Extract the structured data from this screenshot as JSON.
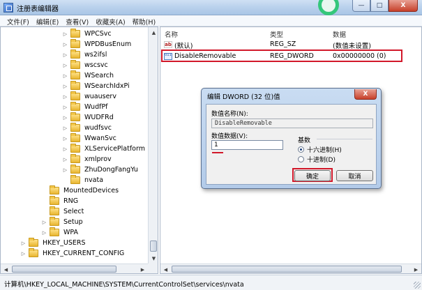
{
  "window": {
    "title": "注册表编辑器",
    "min": "—",
    "max": "□",
    "close": "X"
  },
  "menu": [
    "文件(F)",
    "编辑(E)",
    "查看(V)",
    "收藏夹(A)",
    "帮助(H)"
  ],
  "tree": {
    "items": [
      {
        "label": "WPCSvc",
        "expander": "▷"
      },
      {
        "label": "WPDBusEnum",
        "expander": "▷"
      },
      {
        "label": "ws2ifsl",
        "expander": "▷"
      },
      {
        "label": "wscsvc",
        "expander": "▷"
      },
      {
        "label": "WSearch",
        "expander": "▷"
      },
      {
        "label": "WSearchIdxPi",
        "expander": "▷"
      },
      {
        "label": "wuauserv",
        "expander": "▷"
      },
      {
        "label": "WudfPf",
        "expander": "▷"
      },
      {
        "label": "WUDFRd",
        "expander": "▷"
      },
      {
        "label": "wudfsvc",
        "expander": "▷"
      },
      {
        "label": "WwanSvc",
        "expander": "▷"
      },
      {
        "label": "XLServicePlatform",
        "expander": "▷"
      },
      {
        "label": "xmlprov",
        "expander": "▷"
      },
      {
        "label": "ZhuDongFangYu",
        "expander": "▷"
      },
      {
        "label": "nvata",
        "expander": ""
      },
      {
        "label": "MountedDevices",
        "expander": ""
      },
      {
        "label": "RNG",
        "expander": ""
      },
      {
        "label": "Select",
        "expander": ""
      },
      {
        "label": "Setup",
        "expander": "▷"
      },
      {
        "label": "WPA",
        "expander": "▷"
      },
      {
        "label": "HKEY_USERS",
        "expander": "▷"
      },
      {
        "label": "HKEY_CURRENT_CONFIG",
        "expander": "▷"
      }
    ]
  },
  "values": {
    "columns": {
      "name": "名称",
      "type": "类型",
      "data": "数据"
    },
    "rows": [
      {
        "icon": "ab",
        "name": "(默认)",
        "type": "REG_SZ",
        "data": "(数值未设置)"
      },
      {
        "icon": "011",
        "name": "DisableRemovable",
        "type": "REG_DWORD",
        "data": "0x00000000 (0)"
      }
    ]
  },
  "status": {
    "path": "计算机\\HKEY_LOCAL_MACHINE\\SYSTEM\\CurrentControlSet\\services\\nvata"
  },
  "dialog": {
    "title": "编辑 DWORD (32 位)值",
    "close": "X",
    "name_label": "数值名称(N):",
    "name_value": "DisableRemovable",
    "data_label": "数值数据(V):",
    "data_value": "1",
    "base_label": "基数",
    "hex_label": "十六进制(H)",
    "dec_label": "十进制(D)",
    "ok": "确定",
    "cancel": "取消"
  },
  "colors": {
    "highlight": "#d2182a",
    "selected": "#3399ff"
  }
}
